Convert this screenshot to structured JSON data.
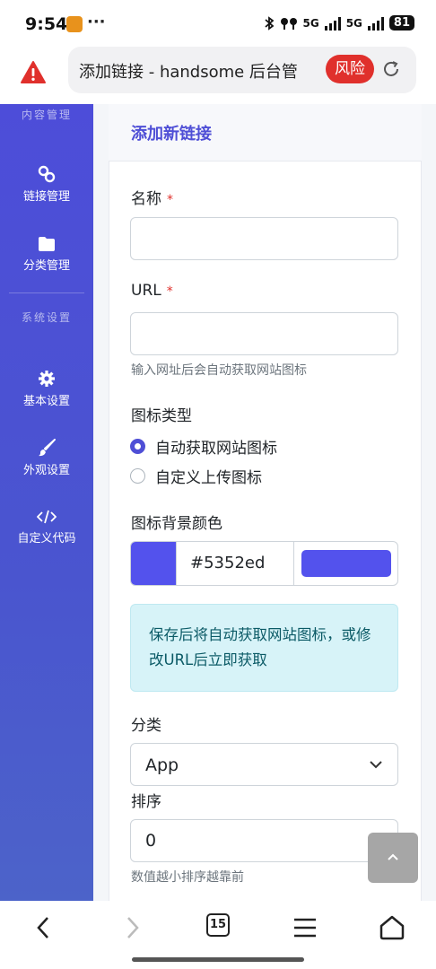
{
  "status_bar": {
    "time": "9:54",
    "more": "···",
    "network1": "5G",
    "network2": "5G",
    "battery": "81"
  },
  "browser": {
    "url_text": "添加链接 - handsome 后台管",
    "risk_label": "风险"
  },
  "sidebar": {
    "group_content": "内容管理",
    "items": [
      {
        "label": "链接管理",
        "icon": "link-icon"
      },
      {
        "label": "分类管理",
        "icon": "folder-icon"
      }
    ],
    "group_system": "系统设置",
    "items2": [
      {
        "label": "基本设置",
        "icon": "gear-icon"
      },
      {
        "label": "外观设置",
        "icon": "brush-icon"
      },
      {
        "label": "自定义代码",
        "icon": "code-icon"
      }
    ]
  },
  "form": {
    "title": "添加新链接",
    "name_label": "名称",
    "required_mark": "*",
    "name_value": "",
    "url_label": "URL",
    "url_value": "",
    "url_help": "输入网址后会自动获取网站图标",
    "icon_type_label": "图标类型",
    "icon_type_options": [
      "自动获取网站图标",
      "自定义上传图标"
    ],
    "icon_type_selected": 0,
    "icon_bg_label": "图标背景颜色",
    "icon_bg_value": "#5352ed",
    "alert_text": "保存后将自动获取网站图标，或修改URL后立即获取",
    "category_label": "分类",
    "category_value": "App",
    "sort_label": "排序",
    "sort_value": "0",
    "sort_help": "数值越小排序越靠前"
  },
  "nav": {
    "tab_count": "15"
  },
  "colors": {
    "accent": "#4f4fd6",
    "swatch": "#5352ed",
    "risk": "#e0302c",
    "alert_bg": "#d7f3f8"
  }
}
